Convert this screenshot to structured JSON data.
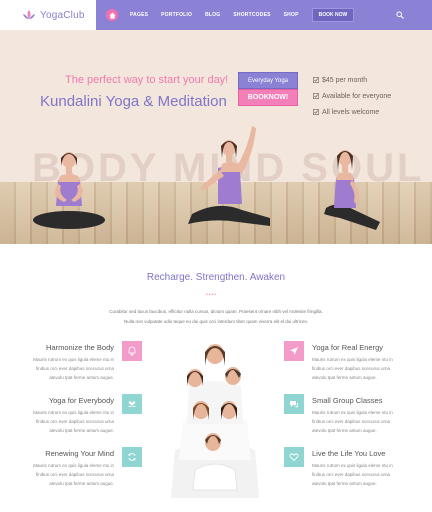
{
  "header": {
    "logo_text": "YogaClub",
    "nav": [
      "PAGES",
      "PORTFOLIO",
      "BLOG",
      "SHORTCODES",
      "SHOP"
    ],
    "book_now": "BOOK NOW"
  },
  "hero": {
    "tagline": "The perfect way to start your day!",
    "headline": "Kundalini Yoga & Meditation",
    "watermark": "BODY MIND SOUL",
    "cta_label": "Everyday Yoga",
    "cta_button": "BOOKNOW!",
    "features": [
      "$45 per month",
      "Available for everyone",
      "All levels welcome"
    ]
  },
  "section": {
    "title": "Recharge. Strengthen. Awaken",
    "dots": "••••",
    "text_line1": "Curabitur sed lacus faucibus, efficitur nulla cursus, dictum quam. Praesent ornare nibh vel molestie fringilla.",
    "text_line2": "Nulla non vulputate odio teque eu dui quis orci interdum tiber quam viverra elit el dui ultrices."
  },
  "services": {
    "left": [
      {
        "title": "Harmonize the Body",
        "desc": "Mauris rutrum ex quis ligula eleme ntu in finibus orci ever dapibus scecurus urna atevolu tpat ferme antum augue.",
        "icon": "bell-icon"
      },
      {
        "title": "Yoga for Everybody",
        "desc": "Mauris rutrum ex quis ligula eleme ntu in finibus orci ever dapibus scecurus urna atevolu tpat ferme antum augue.",
        "icon": "group-icon"
      },
      {
        "title": "Renewing Your Mind",
        "desc": "Mauris rutrum ex quis ligula eleme ntu in finibus orci ever dapibus scecurus urna atevolu tpat ferme antum augue.",
        "icon": "refresh-icon"
      }
    ],
    "right": [
      {
        "title": "Yoga for Real Energy",
        "desc": "Mauris rutrum ex quis ligula eleme ntu in finibus orci ever dapibus scecurus urna atevolu tpat ferme antum augue.",
        "icon": "rocket-icon"
      },
      {
        "title": "Small Group Classes",
        "desc": "Mauris rutrum ex quis ligula eleme ntu in finibus orci ever dapibus scecurus urna atevolu tpat ferme antum augue.",
        "icon": "chat-icon"
      },
      {
        "title": "Live the Life You Love",
        "desc": "Mauris rutrum ex quis ligula eleme ntu in finibus orci ever dapibus scecurus urna atevolu tpat ferme antum augue.",
        "icon": "heart-icon"
      }
    ]
  },
  "colors": {
    "purple": "#8b82d6",
    "pink": "#f37fb8",
    "teal": "#8fd6d2",
    "hero_bg": "#f3e6dc"
  }
}
